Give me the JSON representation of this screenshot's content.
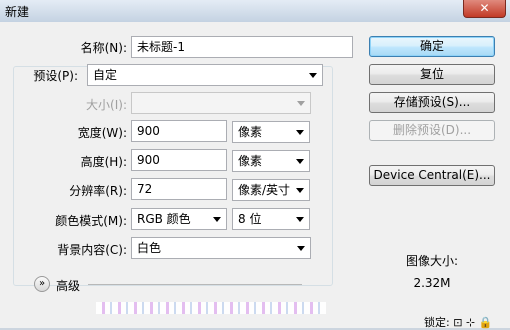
{
  "window": {
    "title": "新建",
    "close_glyph": "✕"
  },
  "fields": {
    "name": {
      "label": "名称(N):",
      "value": "未标题-1"
    },
    "preset": {
      "label": "预设(P):",
      "value": "自定"
    },
    "size": {
      "label": "大小(I):",
      "value": ""
    },
    "width": {
      "label": "宽度(W):",
      "value": "900",
      "unit": "像素"
    },
    "height": {
      "label": "高度(H):",
      "value": "900",
      "unit": "像素"
    },
    "resolution": {
      "label": "分辨率(R):",
      "value": "72",
      "unit": "像素/英寸"
    },
    "color_mode": {
      "label": "颜色模式(M):",
      "value": "RGB 颜色",
      "depth": "8 位"
    },
    "background": {
      "label": "背景内容(C):",
      "value": "白色"
    }
  },
  "buttons": {
    "ok": "确定",
    "reset": "复位",
    "save_preset": "存储预设(S)...",
    "delete_preset": "删除预设(D)...",
    "device_central": "Device Central(E)..."
  },
  "image_size": {
    "label": "图像大小:",
    "value": "2.32M"
  },
  "advanced": {
    "label": "高级",
    "icon": "chevron-double-down-icon"
  },
  "status_fragment": "锁定: ⊡ ⊹ 🔒"
}
